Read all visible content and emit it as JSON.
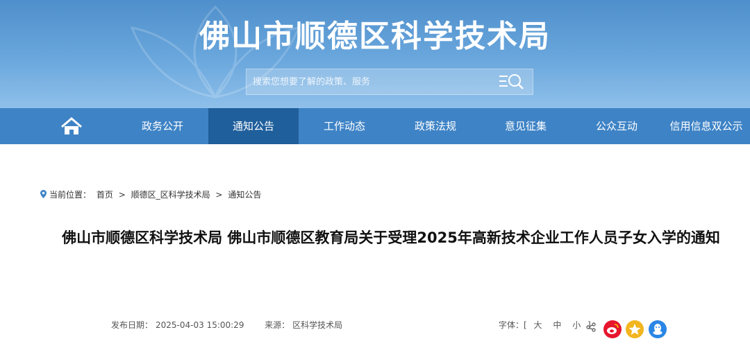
{
  "header": {
    "site_title": "佛山市顺德区科学技术局",
    "search_placeholder": "搜索您想要了解的政策、服务"
  },
  "nav": {
    "items": [
      {
        "label": "政务公开",
        "active": false
      },
      {
        "label": "通知公告",
        "active": true
      },
      {
        "label": "工作动态",
        "active": false
      },
      {
        "label": "政策法规",
        "active": false
      },
      {
        "label": "意见征集",
        "active": false
      },
      {
        "label": "公众互动",
        "active": false
      },
      {
        "label": "信用信息双公示",
        "active": false
      }
    ]
  },
  "breadcrumb": {
    "prefix": "当前位置：",
    "items": [
      "首页",
      "顺德区_区科学技术局",
      "通知公告"
    ],
    "separator": ">"
  },
  "article": {
    "title": "佛山市顺德区科学技术局 佛山市顺德区教育局关于受理2025年高新技术企业工作人员子女入学的通知",
    "date_label": "发布日期：",
    "date": "2025-04-03 15:00:29",
    "source_label": "来源：",
    "source": "区科学技术局"
  },
  "tools": {
    "font_label": "字体：",
    "bracket_open": "[",
    "bracket_close": "]",
    "sizes": [
      "大",
      "中",
      "小"
    ]
  },
  "colors": {
    "nav_bg": "#3e83c6",
    "nav_active": "#1f5f9c",
    "weibo": "#e6162d",
    "favorite": "#f2b51d",
    "qq": "#2a86e6"
  },
  "icons": [
    "home-icon",
    "search-icon",
    "location-pin-icon",
    "share-icon",
    "weibo-icon",
    "star-icon",
    "qq-icon"
  ]
}
